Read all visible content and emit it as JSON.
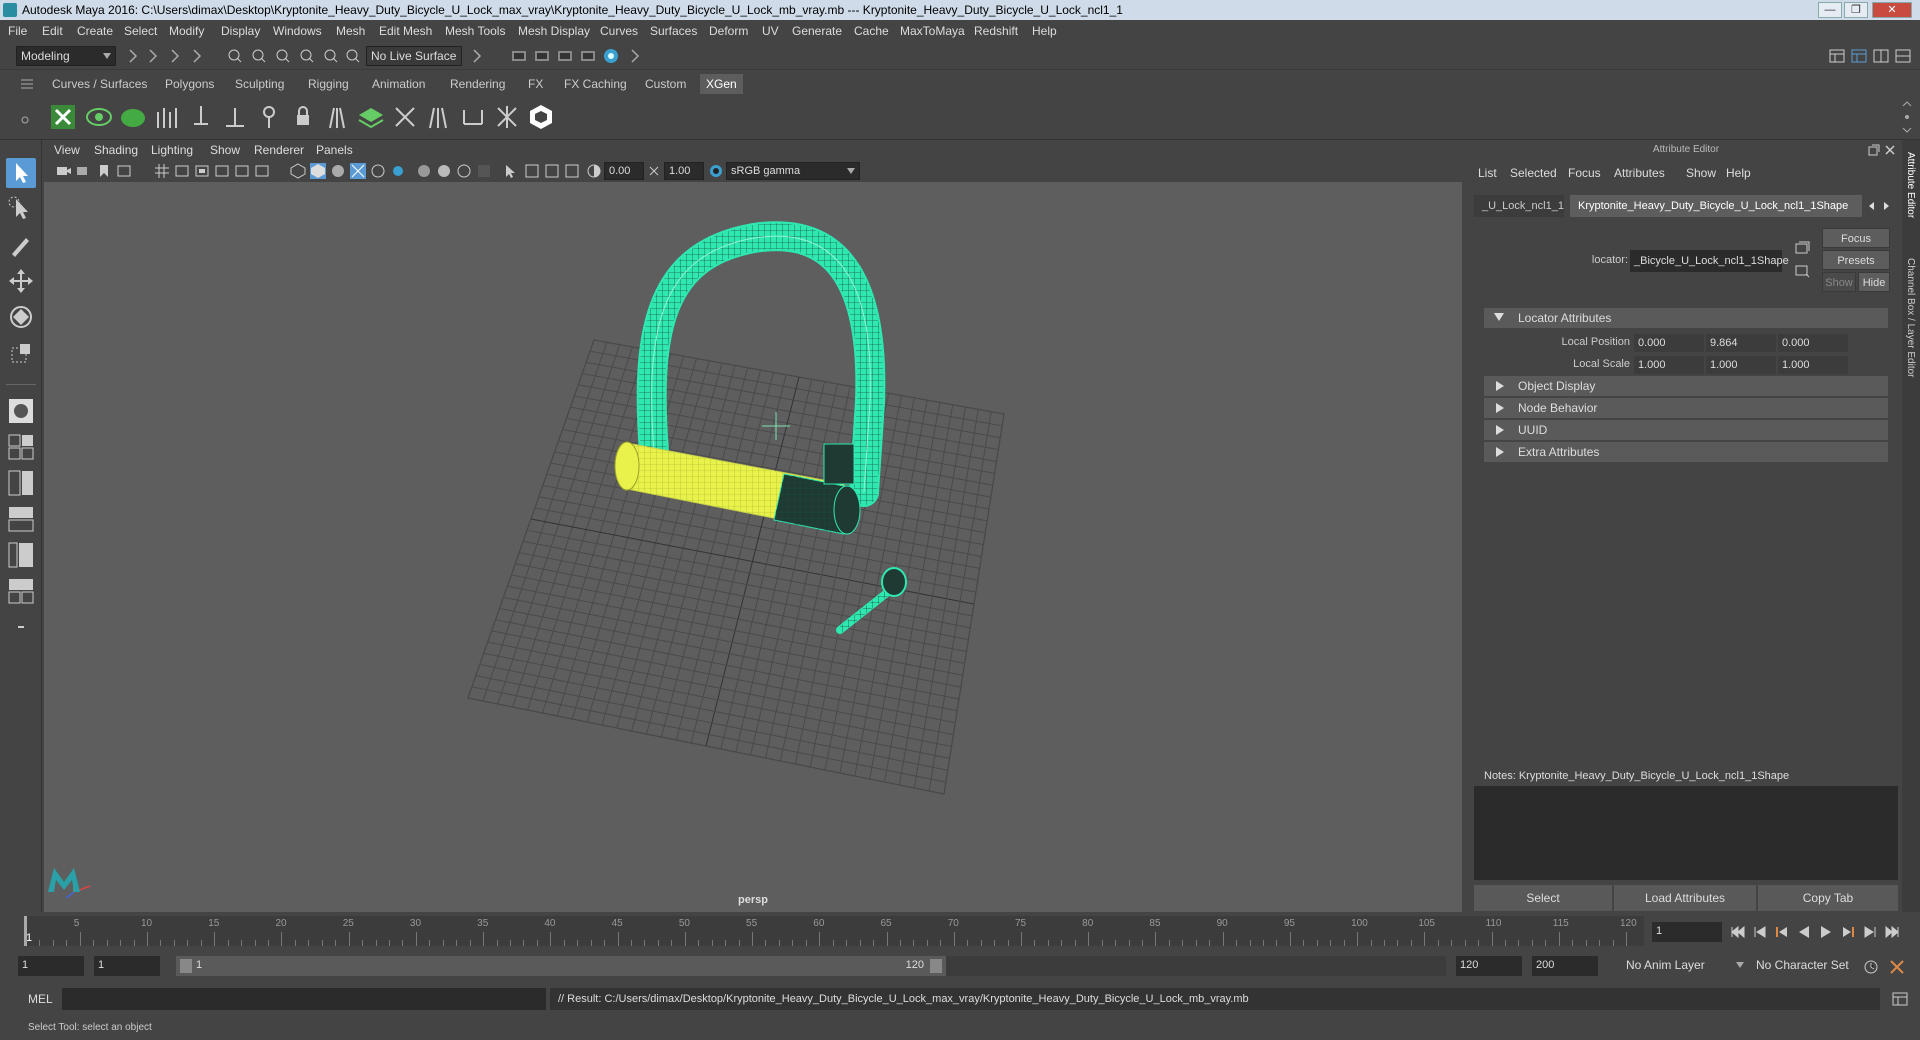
{
  "window": {
    "title": "Autodesk Maya 2016: C:\\Users\\dimax\\Desktop\\Kryptonite_Heavy_Duty_Bicycle_U_Lock_max_vray\\Kryptonite_Heavy_Duty_Bicycle_U_Lock_mb_vray.mb   ---   Kryptonite_Heavy_Duty_Bicycle_U_Lock_ncl1_1",
    "minimize": "—",
    "maximize": "❐",
    "close": "✕"
  },
  "menubar": [
    "File",
    "Edit",
    "Create",
    "Select",
    "Modify",
    "Display",
    "Windows",
    "Mesh",
    "Edit Mesh",
    "Mesh Tools",
    "Mesh Display",
    "Curves",
    "Surfaces",
    "Deform",
    "UV",
    "Generate",
    "Cache",
    "MaxToMaya",
    "Redshift",
    "Help"
  ],
  "statusline": {
    "mode": "Modeling",
    "live_surface": "No Live Surface"
  },
  "shelf_tabs": [
    "Curves / Surfaces",
    "Polygons",
    "Sculpting",
    "Rigging",
    "Animation",
    "Rendering",
    "FX",
    "FX Caching",
    "Custom",
    "XGen"
  ],
  "shelf_active": "XGen",
  "viewport": {
    "menu": [
      "View",
      "Shading",
      "Lighting",
      "Show",
      "Renderer",
      "Panels"
    ],
    "exposure": "0.00",
    "gamma": "1.00",
    "colorspace": "sRGB gamma",
    "camera_label": "persp"
  },
  "attribute_editor": {
    "header": "Attribute Editor",
    "menu": [
      "List",
      "Selected",
      "Focus",
      "Attributes",
      "Show",
      "Help"
    ],
    "tab_left": "_U_Lock_ncl1_1",
    "tab_active": "Kryptonite_Heavy_Duty_Bicycle_U_Lock_ncl1_1Shape",
    "locator_label": "locator:",
    "locator_value": "_Bicycle_U_Lock_ncl1_1Shape",
    "focus_btn": "Focus",
    "presets_btn": "Presets",
    "show_btn": "Show",
    "hide_btn": "Hide",
    "sections": {
      "locator": "Locator Attributes",
      "object_display": "Object Display",
      "node_behavior": "Node Behavior",
      "uuid": "UUID",
      "extra": "Extra Attributes"
    },
    "local_position_label": "Local Position",
    "local_position": [
      "0.000",
      "9.864",
      "0.000"
    ],
    "local_scale_label": "Local Scale",
    "local_scale": [
      "1.000",
      "1.000",
      "1.000"
    ],
    "notes": "Notes:  Kryptonite_Heavy_Duty_Bicycle_U_Lock_ncl1_1Shape",
    "select_btn": "Select",
    "load_btn": "Load Attributes",
    "copy_btn": "Copy Tab"
  },
  "side_tabs": [
    "Attribute Editor",
    "Channel Box / Layer Editor"
  ],
  "timeline": {
    "ticks": [
      "5",
      "10",
      "15",
      "20",
      "25",
      "30",
      "35",
      "40",
      "45",
      "50",
      "55",
      "60",
      "65",
      "70",
      "75",
      "80",
      "85",
      "90",
      "95",
      "100",
      "105",
      "110",
      "115",
      "120"
    ],
    "start_label": "1",
    "current_frame": "1"
  },
  "range": {
    "start": "1",
    "start2": "1",
    "slider_start": "1",
    "slider_end": "120",
    "end": "120",
    "end2": "200",
    "anim_layer": "No Anim Layer",
    "character_set": "No Character Set"
  },
  "cmdline": {
    "lang": "MEL",
    "result": "// Result: C:/Users/dimax/Desktop/Kryptonite_Heavy_Duty_Bicycle_U_Lock_max_vray/Kryptonite_Heavy_Duty_Bicycle_U_Lock_mb_vray.mb"
  },
  "helpline": "Select Tool: select an object"
}
